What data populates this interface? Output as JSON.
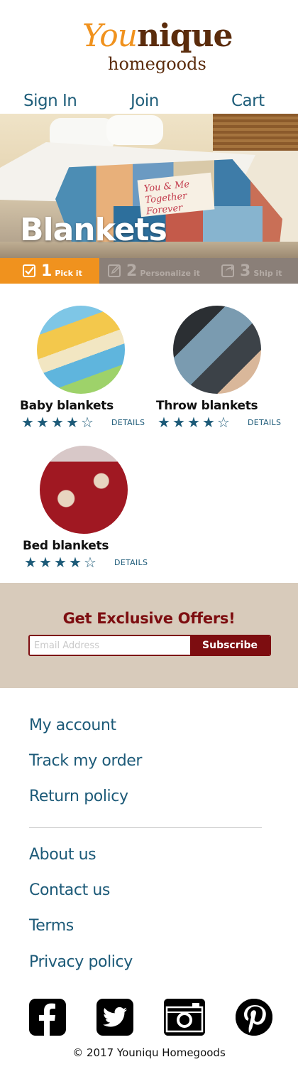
{
  "logo": {
    "part1": "You",
    "part2": "nique",
    "subtitle": "homegoods"
  },
  "nav": {
    "signin": "Sign In",
    "join": "Join",
    "cart": "Cart"
  },
  "hero": {
    "heading": "Blankets",
    "card_line1": "You & Me",
    "card_line2": "Together Forever"
  },
  "steps": [
    {
      "num": "1",
      "label": "Pick it",
      "icon": "checkbox-icon",
      "active": true
    },
    {
      "num": "2",
      "label": "Personalize it",
      "icon": "edit-icon",
      "active": false
    },
    {
      "num": "3",
      "label": "Ship it",
      "icon": "share-icon",
      "active": false
    }
  ],
  "products": [
    {
      "name": "Baby blankets",
      "rating": 4,
      "max_rating": 5,
      "details": "DETAILS"
    },
    {
      "name": "Throw blankets",
      "rating": 4,
      "max_rating": 5,
      "details": "DETAILS"
    },
    {
      "name": "Bed blankets",
      "rating": 4,
      "max_rating": 5,
      "details": "DETAILS"
    }
  ],
  "offers": {
    "title": "Get Exclusive Offers!",
    "placeholder": "Email Address",
    "button": "Subscribe"
  },
  "footer": {
    "links_top": [
      "My account",
      "Track my order",
      "Return policy"
    ],
    "links_bottom": [
      "About us",
      "Contact us",
      "Terms",
      "Privacy policy"
    ],
    "social": [
      "facebook-icon",
      "twitter-icon",
      "camera-icon",
      "pinterest-icon"
    ],
    "copyright": "© 2017 Youniqu Homegoods"
  },
  "colors": {
    "accent": "#f0921e",
    "brand_brown": "#5b2c0c",
    "link": "#1c5a78",
    "offer_red": "#7d0d10",
    "offers_bg": "#d8cbbb"
  }
}
